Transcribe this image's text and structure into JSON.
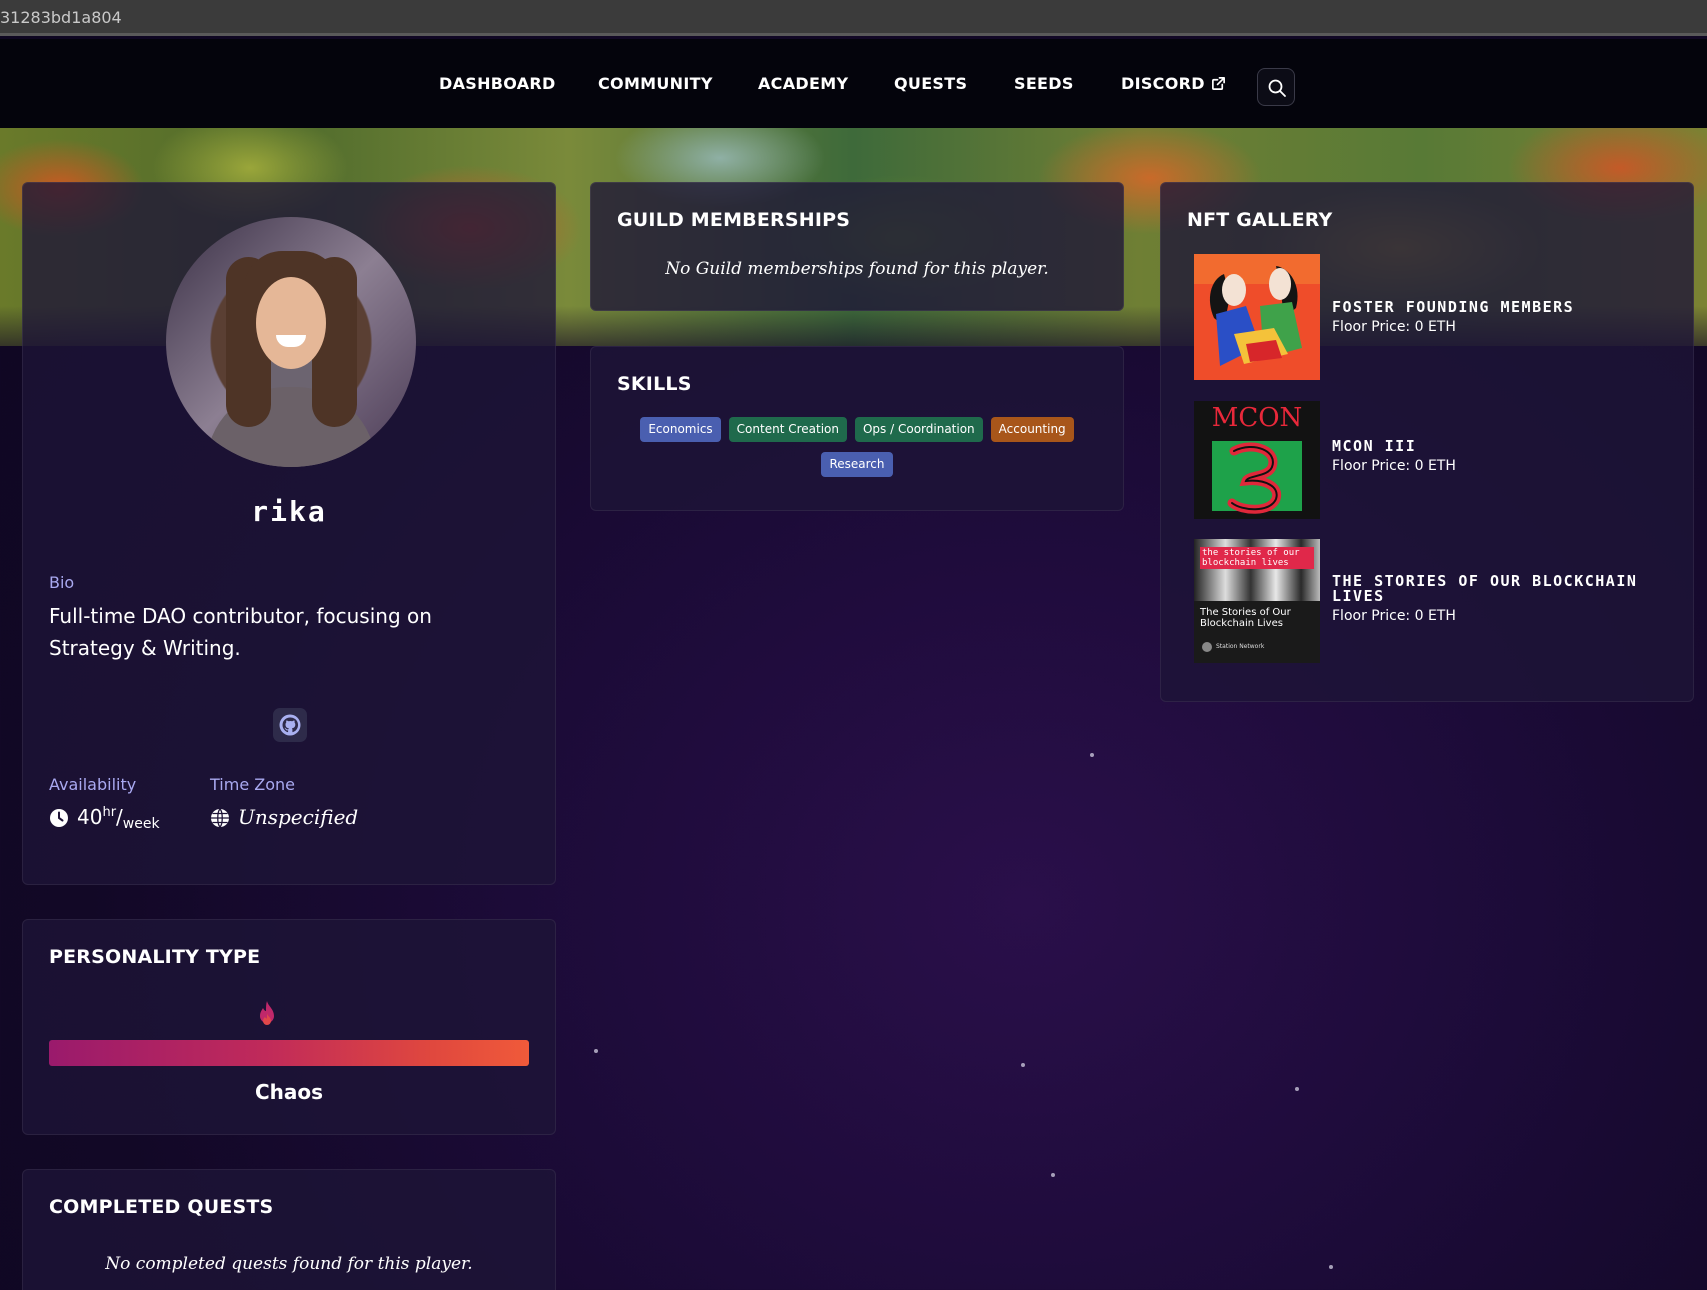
{
  "browser": {
    "url_fragment": "31283bd1a804"
  },
  "nav": {
    "items": [
      "DASHBOARD",
      "COMMUNITY",
      "ACADEMY",
      "QUESTS",
      "SEEDS",
      "DISCORD"
    ]
  },
  "profile": {
    "username": "rika",
    "bio_label": "Bio",
    "bio": "Full-time DAO contributor, focusing on Strategy & Writing.",
    "availability_label": "Availability",
    "availability_value": "40",
    "availability_unit_top": "hr",
    "availability_unit_bottom": "week",
    "timezone_label": "Time Zone",
    "timezone_value": "Unspecified",
    "social_icon": "github-icon"
  },
  "personality": {
    "title": "PERSONALITY TYPE",
    "type": "Chaos",
    "icon": "flame-icon",
    "gradient": [
      "#9a1a6c",
      "#f05a3a"
    ]
  },
  "completed_quests": {
    "title": "COMPLETED QUESTS",
    "empty": "No completed quests found for this player."
  },
  "guilds": {
    "title": "GUILD MEMBERSHIPS",
    "empty": "No Guild memberships found for this player."
  },
  "skills": {
    "title": "SKILLS",
    "tags": [
      {
        "label": "Economics",
        "color": "#4a5fb0"
      },
      {
        "label": "Content Creation",
        "color": "#1f6a4c"
      },
      {
        "label": "Ops / Coordination",
        "color": "#1f6a4c"
      },
      {
        "label": "Accounting",
        "color": "#a8561a"
      },
      {
        "label": "Research",
        "color": "#4a5fb0"
      }
    ]
  },
  "nft_gallery": {
    "title": "NFT GALLERY",
    "items": [
      {
        "title": "Foster Founding Members",
        "price": "Floor Price: 0 ETH"
      },
      {
        "title": "MCON III",
        "price": "Floor Price: 0 ETH",
        "thumb_text": "MCON"
      },
      {
        "title": "The Stories of Our Blockchain Lives",
        "price": "Floor Price: 0 ETH",
        "thumb_banner": "the stories of our blockchain lives",
        "thumb_caption": "The Stories of Our Blockchain Lives",
        "thumb_footer": "Station Network"
      }
    ]
  }
}
